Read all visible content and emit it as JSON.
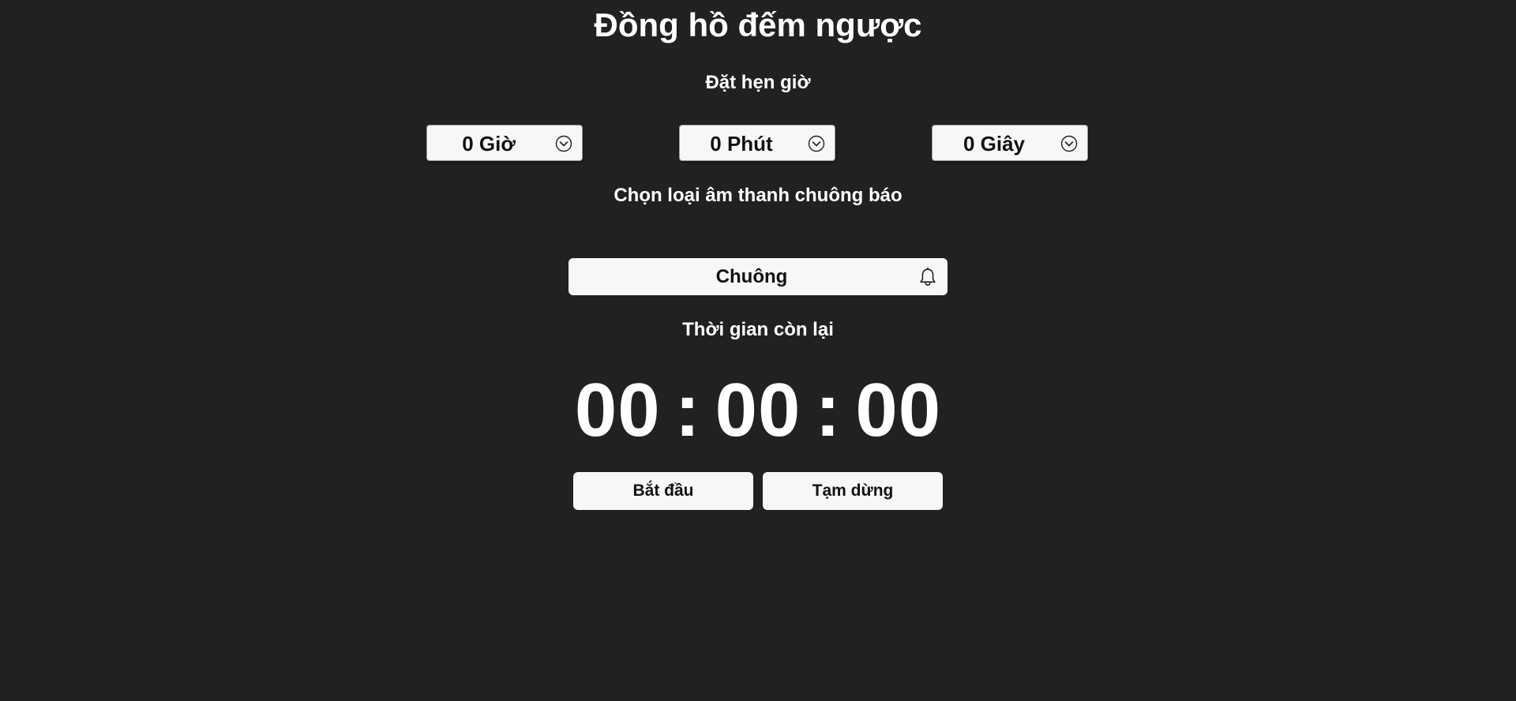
{
  "header": {
    "title": "Đồng hồ đếm ngược"
  },
  "set_timer": {
    "label": "Đặt hẹn giờ",
    "hours": {
      "value": "0 Giờ",
      "icon": "chevron-down-circle-icon"
    },
    "minutes": {
      "value": "0 Phút",
      "icon": "chevron-down-circle-icon"
    },
    "seconds": {
      "value": "0 Giây",
      "icon": "chevron-down-circle-icon"
    }
  },
  "sound": {
    "label": "Chọn loại âm thanh chuông báo",
    "value": "Chuông",
    "icon": "bell-icon"
  },
  "remaining": {
    "label": "Thời gian còn lại",
    "hours": "00",
    "minutes": "00",
    "seconds": "00",
    "separator": ":"
  },
  "controls": {
    "start_label": "Bắt đầu",
    "pause_label": "Tạm dừng"
  },
  "colors": {
    "background": "#212121",
    "text": "#ffffff",
    "control_bg": "#f6f7f9",
    "control_text": "#111111"
  }
}
